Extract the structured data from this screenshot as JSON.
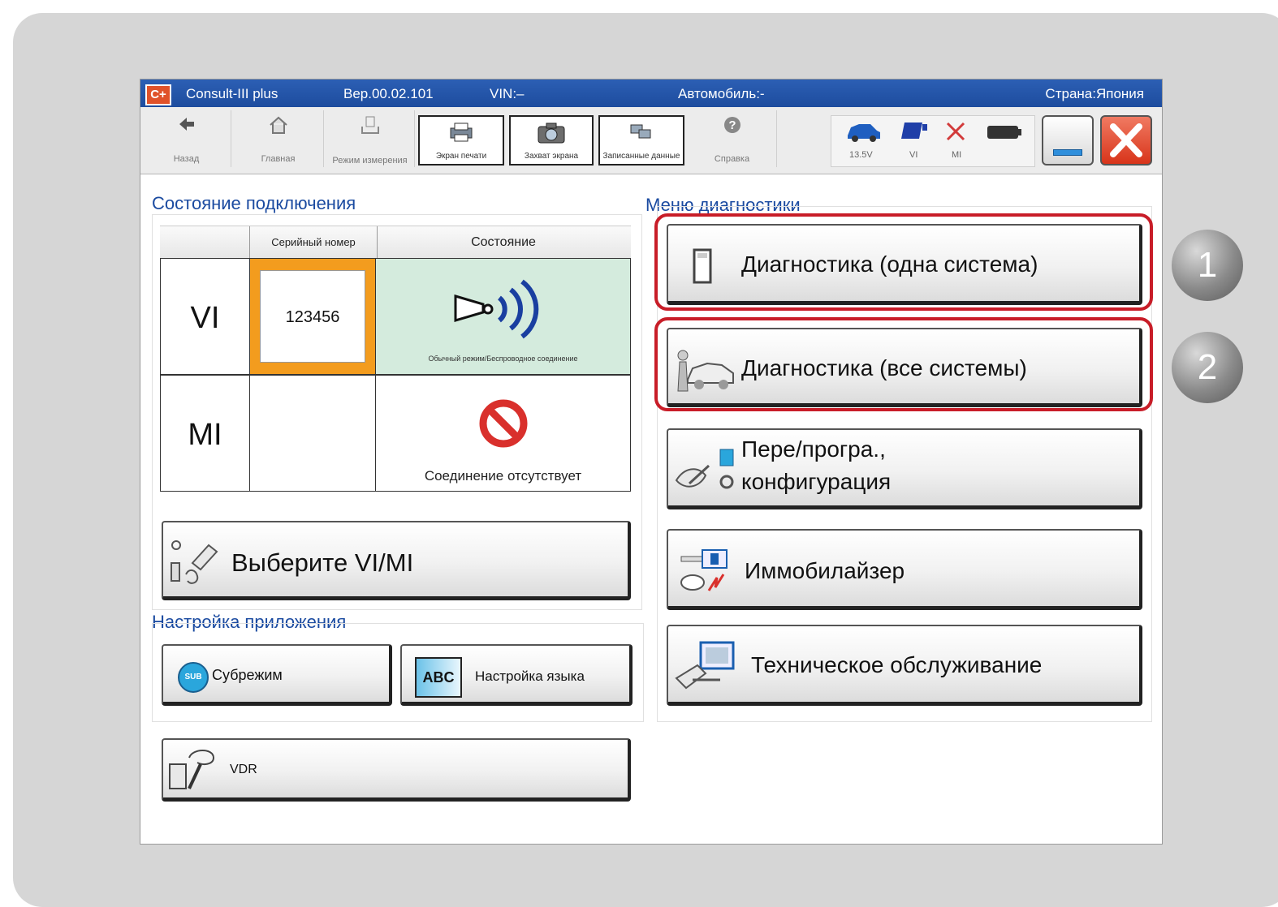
{
  "titlebar": {
    "app": "Consult-III plus",
    "version": "Вер.00.02.101",
    "vin": "VIN:–",
    "vehicle": "Автомобиль:-",
    "country": "Страна:Япония"
  },
  "toolbar": {
    "back": "Назад",
    "home": "Главная",
    "mode": "Режим измерения",
    "print": "Экран печати",
    "capture": "Захват экрана",
    "recorded": "Записанные данные",
    "help": "Справка",
    "voltage": "13.5V",
    "vi": "VI",
    "mi": "MI"
  },
  "connection": {
    "title": "Состояние подключения",
    "col_serial": "Серийный номер",
    "col_status": "Состояние",
    "rows": [
      {
        "device": "VI",
        "serial": "123456",
        "status": "Обычный режим/Беспроводное соединение"
      },
      {
        "device": "MI",
        "serial": "",
        "status": "Соединение отсутствует"
      }
    ],
    "select_button": "Выберите VI/MI"
  },
  "app_settings": {
    "title": "Настройка приложения",
    "submode": "Субрежим",
    "sub_badge": "SUB",
    "language": "Настройка языка",
    "lang_badge": "ABC"
  },
  "vdr": {
    "label": "VDR"
  },
  "diag": {
    "title": "Меню диагностики",
    "items": [
      {
        "label": "Диагностика (одна система)"
      },
      {
        "label": "Диагностика (все системы)"
      },
      {
        "label": "Пере/програ.,",
        "label2": "конфигурация"
      },
      {
        "label": "Иммобилайзер"
      },
      {
        "label": "Техническое обслуживание"
      }
    ]
  },
  "markers": [
    "1",
    "2"
  ],
  "colors": {
    "titlebar": "#1d4c9e",
    "highlight": "#c81d28",
    "connected_bg": "#d4ebdd",
    "serial_border": "#f39c1e",
    "no_connection": "#d9302c"
  }
}
